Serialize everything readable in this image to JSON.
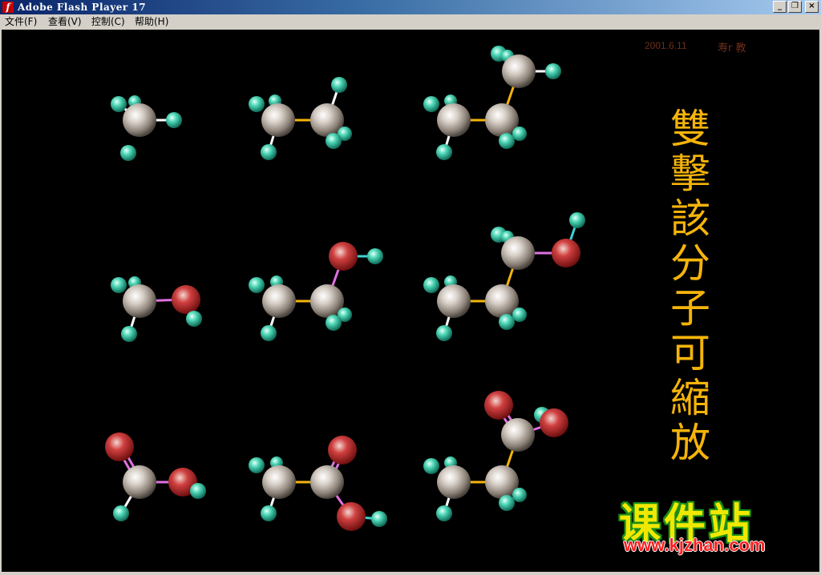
{
  "window": {
    "title": "Adobe Flash Player 17",
    "app_icon": "flash-player-icon",
    "buttons": {
      "minimize": "_",
      "restore": "❐",
      "close": "×"
    }
  },
  "menu": [
    {
      "label": "文件(F)"
    },
    {
      "label": "查看(V)"
    },
    {
      "label": "控制(C)"
    },
    {
      "label": "帮助(H)"
    }
  ],
  "stage": {
    "date": "2001.6.11",
    "author": "寿r 教",
    "vertical_title": "雙擊該分子可縮放",
    "logo_text": "课件站",
    "logo_url": "www.kjzhan.com"
  },
  "colors": {
    "background": "#000000",
    "title_text": "#f5b40a",
    "carbon": "#8c8278",
    "hydrogen": "#2bbf9f",
    "oxygen": "#c83030",
    "bond_cc": "#f5b40a",
    "bond_ch": "#ffffff",
    "bond_co": "#e070e0",
    "bond_oh": "#40d0d0"
  },
  "molecules": [
    {
      "id": "methane",
      "atoms": [
        [
          "C",
          174,
          150,
          21
        ],
        [
          "H",
          148,
          130,
          10
        ],
        [
          "H",
          168,
          127,
          8
        ],
        [
          "H",
          217,
          150,
          10
        ],
        [
          "H",
          160,
          191,
          10
        ]
      ],
      "bonds": [
        [
          0,
          2,
          "ch"
        ],
        [
          0,
          3,
          "ch"
        ],
        [
          0,
          1,
          "ch"
        ]
      ]
    },
    {
      "id": "ethane",
      "atoms": [
        [
          "C",
          347,
          150,
          21
        ],
        [
          "C",
          408,
          150,
          21
        ],
        [
          "H",
          320,
          130,
          10
        ],
        [
          "H",
          343,
          126,
          8
        ],
        [
          "H",
          335,
          190,
          10
        ],
        [
          "H",
          423,
          106,
          10
        ],
        [
          "H",
          430,
          167,
          9
        ],
        [
          "H",
          416,
          176,
          10
        ]
      ],
      "bonds": [
        [
          0,
          1,
          "cc"
        ],
        [
          0,
          4,
          "ch"
        ],
        [
          1,
          5,
          "ch"
        ]
      ]
    },
    {
      "id": "propane",
      "atoms": [
        [
          "C",
          566,
          150,
          21
        ],
        [
          "C",
          626,
          150,
          21
        ],
        [
          "C",
          647,
          89,
          21
        ],
        [
          "H",
          538,
          130,
          10
        ],
        [
          "H",
          562,
          126,
          8
        ],
        [
          "H",
          554,
          190,
          10
        ],
        [
          "H",
          648,
          167,
          9
        ],
        [
          "H",
          632,
          176,
          10
        ],
        [
          "H",
          622,
          67,
          10
        ],
        [
          "H",
          633,
          70,
          8
        ],
        [
          "H",
          690,
          89,
          10
        ]
      ],
      "bonds": [
        [
          0,
          1,
          "cc"
        ],
        [
          1,
          2,
          "cc"
        ],
        [
          0,
          5,
          "ch"
        ],
        [
          2,
          10,
          "ch"
        ]
      ]
    },
    {
      "id": "methanol",
      "atoms": [
        [
          "C",
          174,
          376,
          21
        ],
        [
          "O",
          232,
          374,
          18
        ],
        [
          "H",
          148,
          356,
          10
        ],
        [
          "H",
          168,
          353,
          8
        ],
        [
          "H",
          161,
          417,
          10
        ],
        [
          "H",
          242,
          398,
          10
        ]
      ],
      "bonds": [
        [
          0,
          1,
          "co"
        ],
        [
          0,
          4,
          "ch"
        ]
      ]
    },
    {
      "id": "ethanol",
      "atoms": [
        [
          "C",
          348,
          376,
          21
        ],
        [
          "C",
          408,
          376,
          21
        ],
        [
          "O",
          428,
          320,
          18
        ],
        [
          "H",
          320,
          356,
          10
        ],
        [
          "H",
          345,
          352,
          8
        ],
        [
          "H",
          335,
          416,
          10
        ],
        [
          "H",
          430,
          393,
          9
        ],
        [
          "H",
          416,
          403,
          10
        ],
        [
          "H",
          468,
          320,
          10
        ]
      ],
      "bonds": [
        [
          0,
          1,
          "cc"
        ],
        [
          1,
          2,
          "co"
        ],
        [
          0,
          5,
          "ch"
        ],
        [
          2,
          8,
          "oh"
        ]
      ]
    },
    {
      "id": "propanol",
      "atoms": [
        [
          "C",
          566,
          376,
          21
        ],
        [
          "C",
          626,
          376,
          21
        ],
        [
          "C",
          646,
          316,
          21
        ],
        [
          "O",
          706,
          316,
          18
        ],
        [
          "H",
          538,
          356,
          10
        ],
        [
          "H",
          562,
          352,
          8
        ],
        [
          "H",
          554,
          416,
          10
        ],
        [
          "H",
          648,
          393,
          9
        ],
        [
          "H",
          632,
          402,
          10
        ],
        [
          "H",
          622,
          293,
          10
        ],
        [
          "H",
          633,
          296,
          8
        ],
        [
          "H",
          720,
          275,
          10
        ]
      ],
      "bonds": [
        [
          0,
          1,
          "cc"
        ],
        [
          1,
          2,
          "cc"
        ],
        [
          2,
          3,
          "co"
        ],
        [
          3,
          11,
          "oh"
        ],
        [
          0,
          6,
          "ch"
        ]
      ]
    },
    {
      "id": "formic-acid",
      "atoms": [
        [
          "C",
          174,
          602,
          21
        ],
        [
          "O",
          149,
          558,
          18
        ],
        [
          "O",
          228,
          602,
          18
        ],
        [
          "H",
          151,
          641,
          10
        ],
        [
          "H",
          247,
          613,
          10
        ]
      ],
      "bonds": [
        [
          0,
          1,
          "co2"
        ],
        [
          0,
          2,
          "co"
        ],
        [
          0,
          3,
          "ch"
        ]
      ]
    },
    {
      "id": "acetic-acid",
      "atoms": [
        [
          "C",
          348,
          602,
          21
        ],
        [
          "C",
          408,
          602,
          21
        ],
        [
          "O",
          427,
          562,
          18
        ],
        [
          "O",
          438,
          645,
          18
        ],
        [
          "H",
          320,
          581,
          10
        ],
        [
          "H",
          345,
          578,
          8
        ],
        [
          "H",
          335,
          641,
          10
        ],
        [
          "H",
          473,
          648,
          10
        ]
      ],
      "bonds": [
        [
          0,
          1,
          "cc"
        ],
        [
          1,
          2,
          "co2"
        ],
        [
          1,
          3,
          "co"
        ],
        [
          3,
          7,
          "oh"
        ],
        [
          0,
          6,
          "ch"
        ]
      ]
    },
    {
      "id": "propanoic-acid",
      "atoms": [
        [
          "C",
          566,
          602,
          21
        ],
        [
          "C",
          626,
          602,
          21
        ],
        [
          "C",
          646,
          543,
          21
        ],
        [
          "O",
          622,
          506,
          18
        ],
        [
          "O",
          691,
          528,
          18
        ],
        [
          "H",
          538,
          582,
          10
        ],
        [
          "H",
          562,
          578,
          8
        ],
        [
          "H",
          554,
          641,
          10
        ],
        [
          "H",
          648,
          618,
          9
        ],
        [
          "H",
          632,
          628,
          10
        ],
        [
          "H",
          676,
          518,
          10
        ]
      ],
      "bonds": [
        [
          0,
          1,
          "cc"
        ],
        [
          1,
          2,
          "cc"
        ],
        [
          2,
          3,
          "co2"
        ],
        [
          2,
          4,
          "co"
        ],
        [
          0,
          7,
          "ch"
        ]
      ]
    }
  ]
}
